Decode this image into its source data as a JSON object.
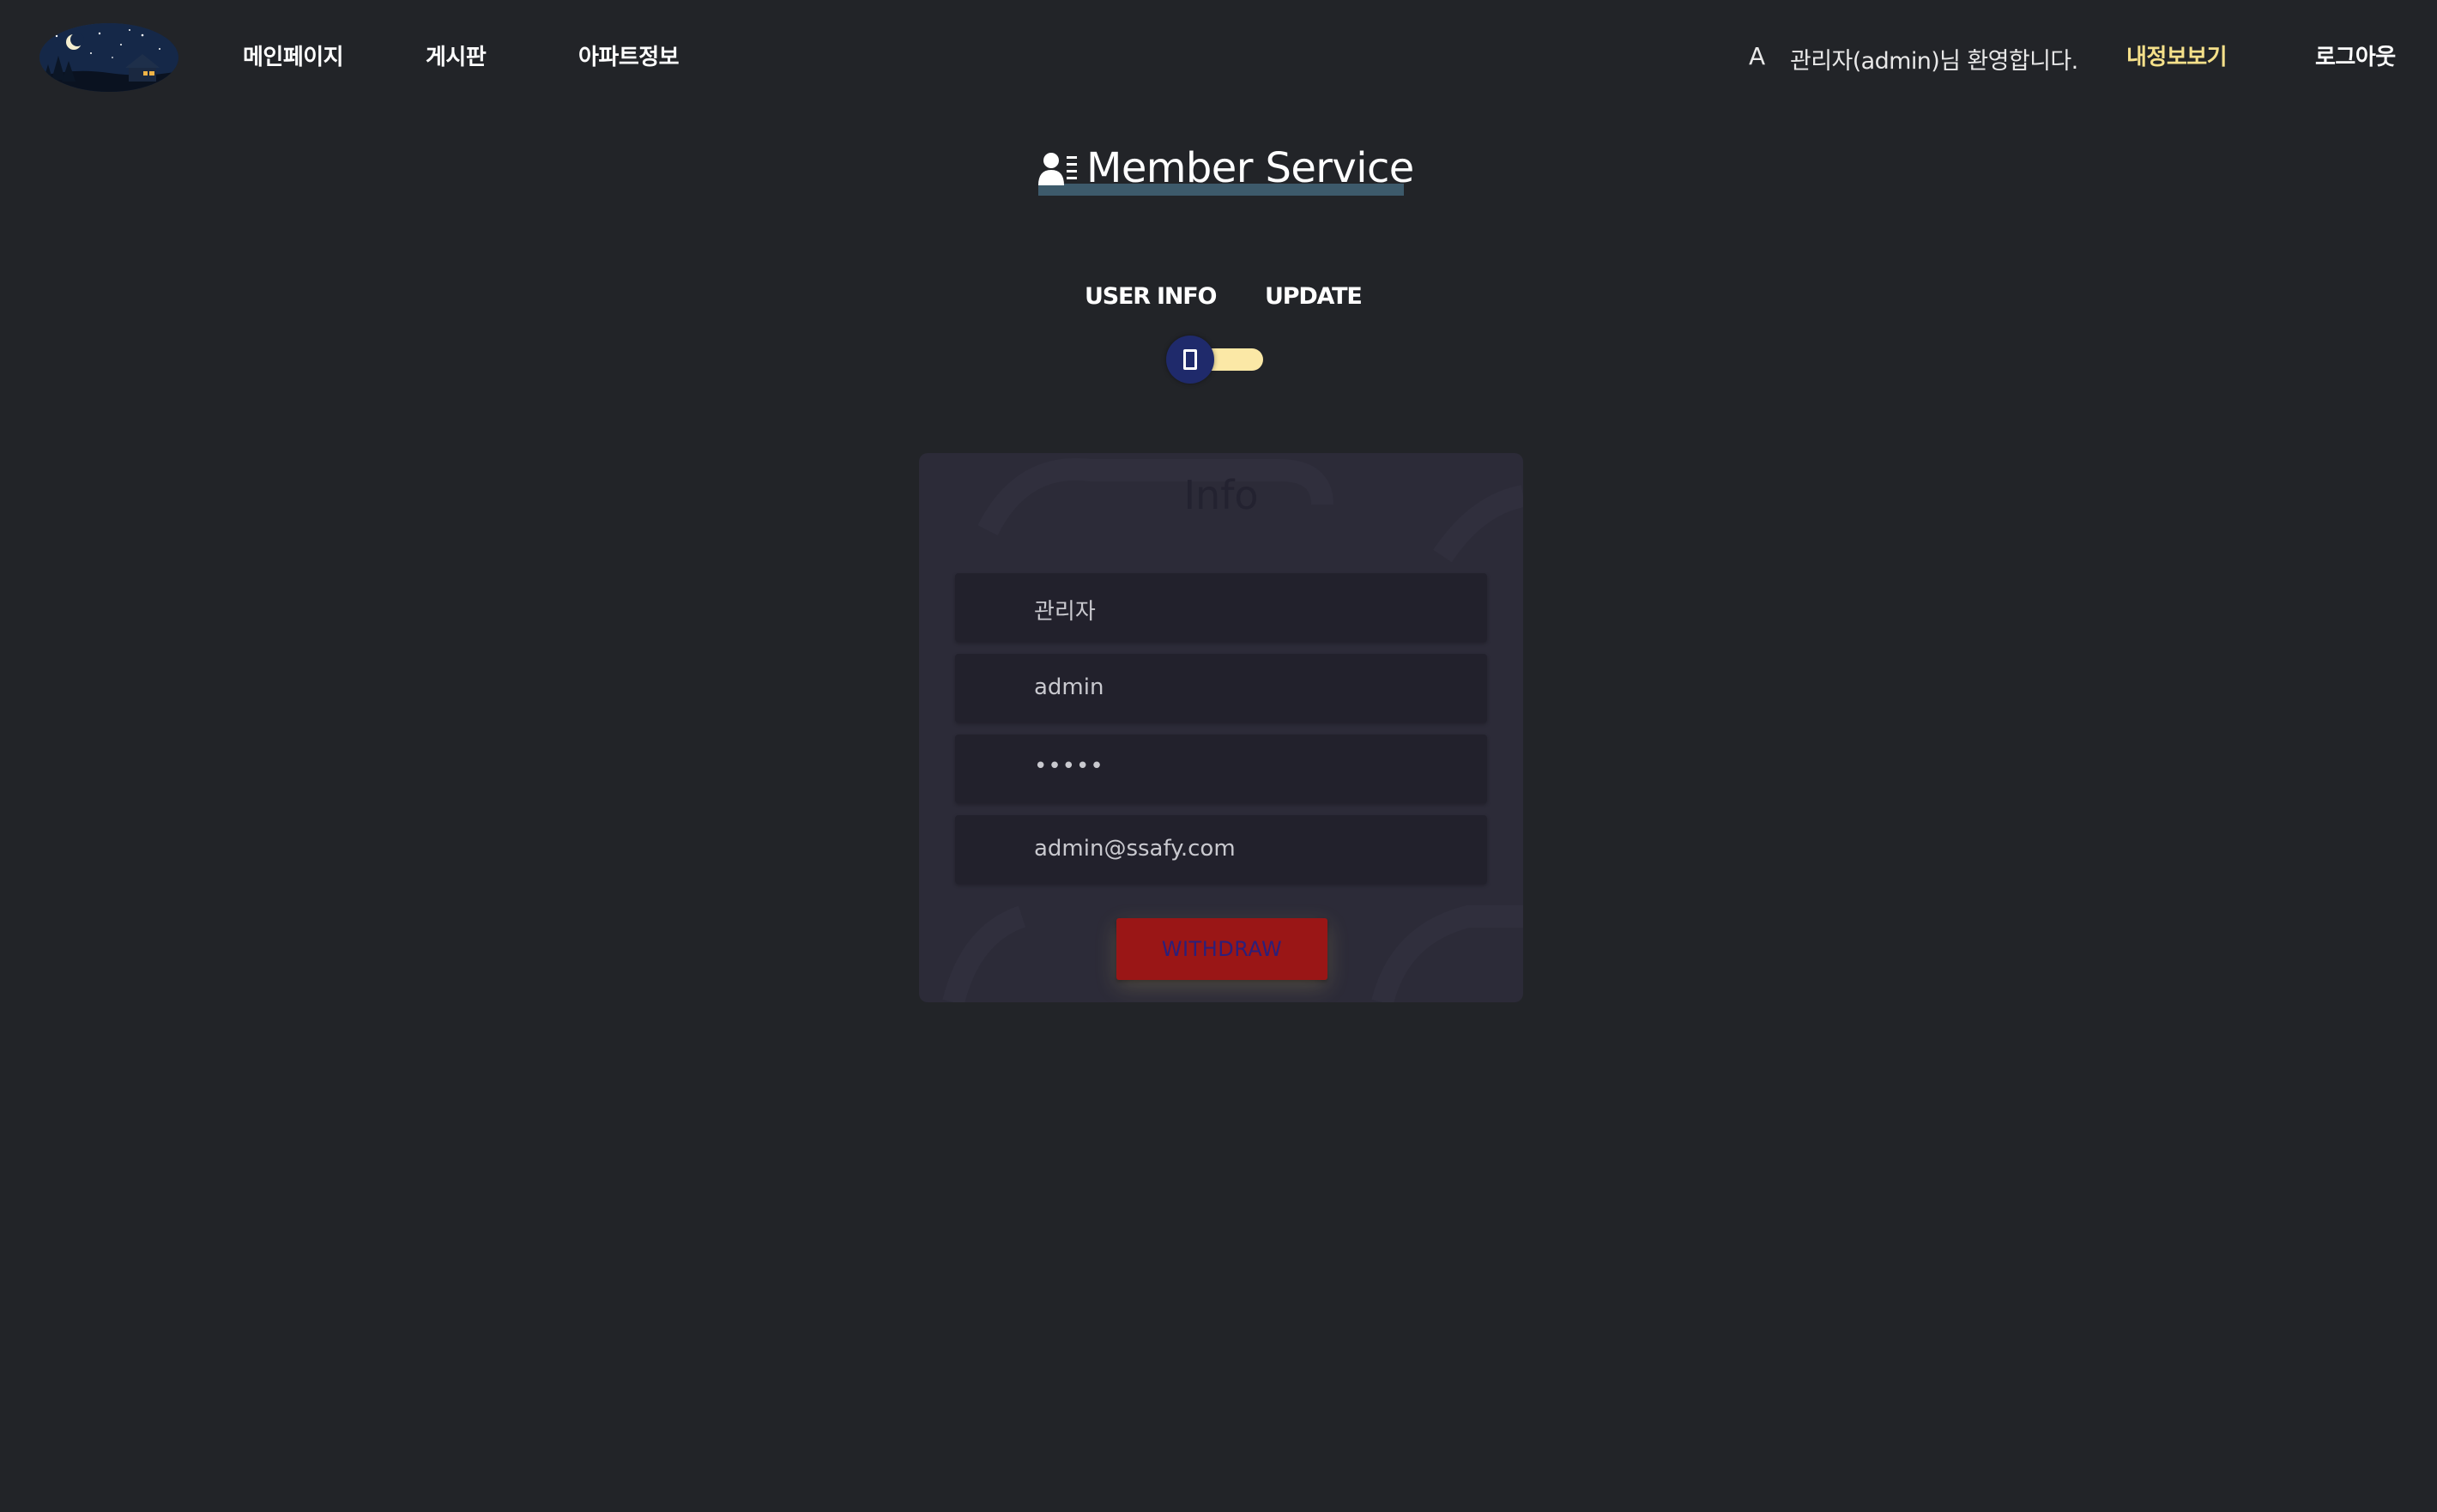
{
  "header": {
    "nav": {
      "main": "메인페이지",
      "board": "게시판",
      "apartment": "아파트정보"
    },
    "user_avatar": "A",
    "welcome": "관리자(admin)님 환영합니다.",
    "mypage": "내정보보기",
    "logout": "로그아웃"
  },
  "page": {
    "title": "Member Service"
  },
  "tabs": {
    "info": "USER INFO",
    "update": "UPDATE",
    "selected": "USER INFO"
  },
  "card": {
    "title": "Info",
    "fields": {
      "name": "관리자",
      "id": "admin",
      "password": "•••••",
      "email": "admin@ssafy.com"
    },
    "withdraw_label": "WITHDRAW"
  },
  "colors": {
    "background": "#222428",
    "accent_mypage": "#f5e08a",
    "switch_track": "#fbe8a6",
    "switch_knob": "#1f2a6b",
    "withdraw": "#9a1616",
    "card": "#2c2b38"
  },
  "icons": {
    "logo": "night-house-logo",
    "title": "user-card-icon",
    "switch": "toggle-knob-icon"
  }
}
